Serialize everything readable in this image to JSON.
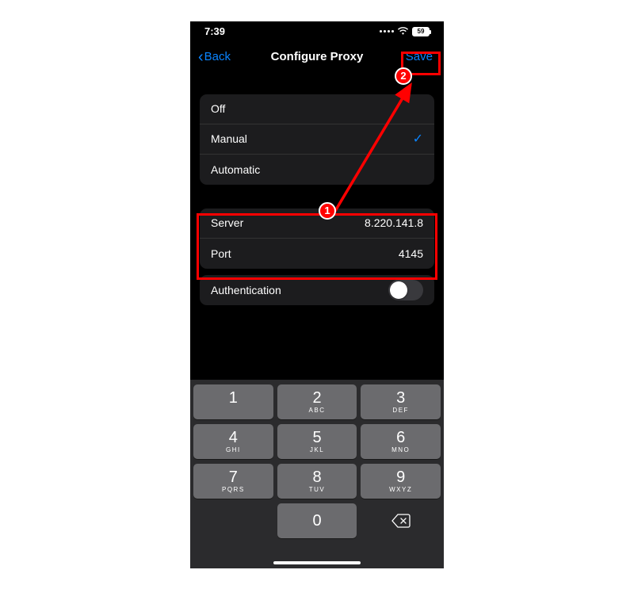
{
  "status": {
    "time": "7:39",
    "battery": "59"
  },
  "nav": {
    "back": "Back",
    "title": "Configure Proxy",
    "save": "Save"
  },
  "mode": {
    "off": "Off",
    "manual": "Manual",
    "automatic": "Automatic"
  },
  "config": {
    "server_label": "Server",
    "server_value": "8.220.141.8",
    "port_label": "Port",
    "port_value": "4145",
    "auth_label": "Authentication"
  },
  "keypad": {
    "k1": "1",
    "k2": "2",
    "k2s": "ABC",
    "k3": "3",
    "k3s": "DEF",
    "k4": "4",
    "k4s": "GHI",
    "k5": "5",
    "k5s": "JKL",
    "k6": "6",
    "k6s": "MNO",
    "k7": "7",
    "k7s": "PQRS",
    "k8": "8",
    "k8s": "TUV",
    "k9": "9",
    "k9s": "WXYZ",
    "k0": "0"
  },
  "annotations": {
    "badge1": "1",
    "badge2": "2"
  }
}
